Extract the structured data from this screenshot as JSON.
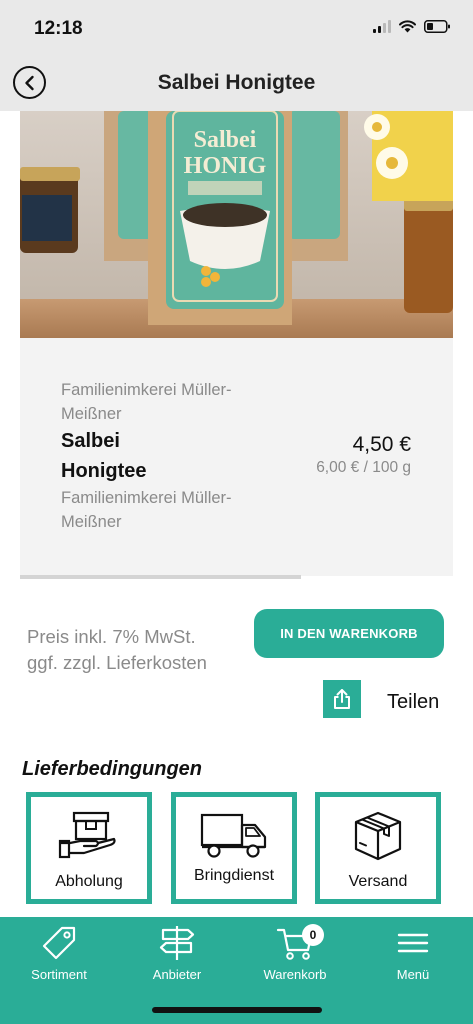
{
  "status_bar": {
    "time": "12:18",
    "icons": [
      "cellular-signal-icon",
      "wifi-icon",
      "battery-icon"
    ]
  },
  "header": {
    "title": "Salbei Honigtee",
    "back_icon": "chevron-left-icon"
  },
  "product": {
    "image_label_top": "Salbei",
    "image_label_bottom": "HONIG",
    "vendor_top": "Familienimkerei Müller-Meißner",
    "name": "Salbei Honigtee",
    "vendor_bottom": "Familienimkerei Müller-Meißner",
    "price": "4,50 €",
    "unit_price": "6,00 € / 100 g"
  },
  "purchase": {
    "price_note": "Preis inkl. 7% MwSt. ggf. zzgl. Lieferkosten",
    "cart_button_label": "IN DEN WARENKORB",
    "share_label": "Teilen",
    "share_icon": "share-icon"
  },
  "delivery": {
    "heading": "Lieferbedingungen",
    "options": [
      {
        "label": "Abholung",
        "icon": "package-hand-icon"
      },
      {
        "label": "Bringdienst",
        "icon": "delivery-truck-icon"
      },
      {
        "label": "Versand",
        "icon": "shipping-box-icon"
      }
    ]
  },
  "tab_bar": {
    "tabs": [
      {
        "label": "Sortiment",
        "icon": "tag-icon"
      },
      {
        "label": "Anbieter",
        "icon": "signpost-icon"
      },
      {
        "label": "Warenkorb",
        "icon": "cart-icon"
      },
      {
        "label": "Menü",
        "icon": "hamburger-menu-icon"
      }
    ],
    "cart_count": "0"
  },
  "colors": {
    "accent": "#2aad97",
    "chrome": "#e9e9e9",
    "card": "#f3f3f3",
    "muted_text": "#8a8a8a"
  }
}
